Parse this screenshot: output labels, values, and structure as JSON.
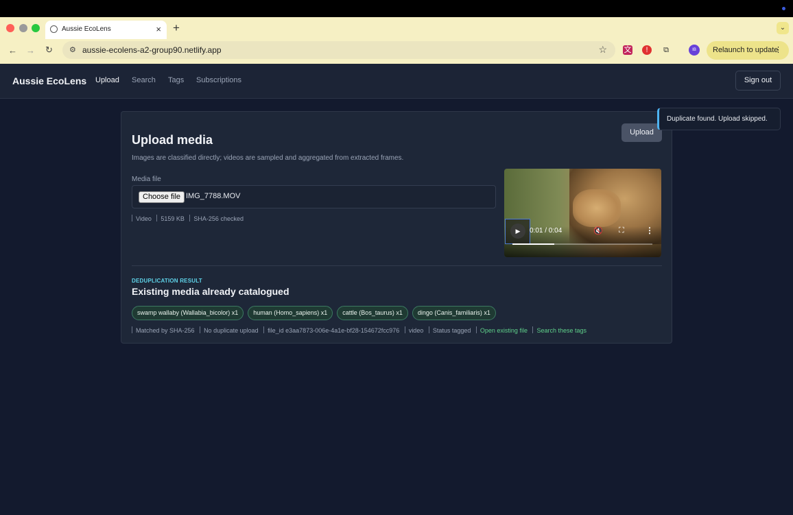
{
  "browser": {
    "tab_title": "Aussie EcoLens",
    "tab_close": "×",
    "new_tab": "+",
    "url": "aussie-ecolens-a2-group90.netlify.app",
    "relaunch_label": "Relaunch to update",
    "profile_initials": "IB",
    "colors": {
      "close": "#ff5f57",
      "minimize": "#febc2e",
      "maximize": "#28c840"
    }
  },
  "app": {
    "brand": "Aussie EcoLens",
    "nav": [
      {
        "label": "Upload",
        "active": true
      },
      {
        "label": "Search",
        "active": false
      },
      {
        "label": "Tags",
        "active": false
      },
      {
        "label": "Subscriptions",
        "active": false
      }
    ],
    "sign_out": "Sign out"
  },
  "upload": {
    "title": "Upload media",
    "subtitle": "Images are classified directly; videos are sampled and aggregated from extracted frames.",
    "button": "Upload",
    "field_label": "Media file",
    "choose_file": "Choose file",
    "file_name": "IMG_7788.MOV",
    "meta": [
      "Video",
      "5159 KB",
      "SHA-256 checked"
    ],
    "video": {
      "time": "0:01 / 0:04",
      "progress": 0.3
    }
  },
  "dedup": {
    "label": "DEDUPLICATION RESULT",
    "title": "Existing media already catalogued",
    "tags": [
      "swamp wallaby (Wallabia_bicolor) x1",
      "human (Homo_sapiens) x1",
      "cattle (Bos_taurus) x1",
      "dingo (Canis_familiaris) x1"
    ],
    "meta": [
      "Matched by SHA-256",
      "No duplicate upload",
      "file_id e3aa7873-006e-4a1e-bf28-154672fcc976",
      "video",
      "Status tagged"
    ],
    "open_link": "Open existing file",
    "search_link": "Search these tags"
  },
  "toast": "Duplicate found. Upload skipped."
}
